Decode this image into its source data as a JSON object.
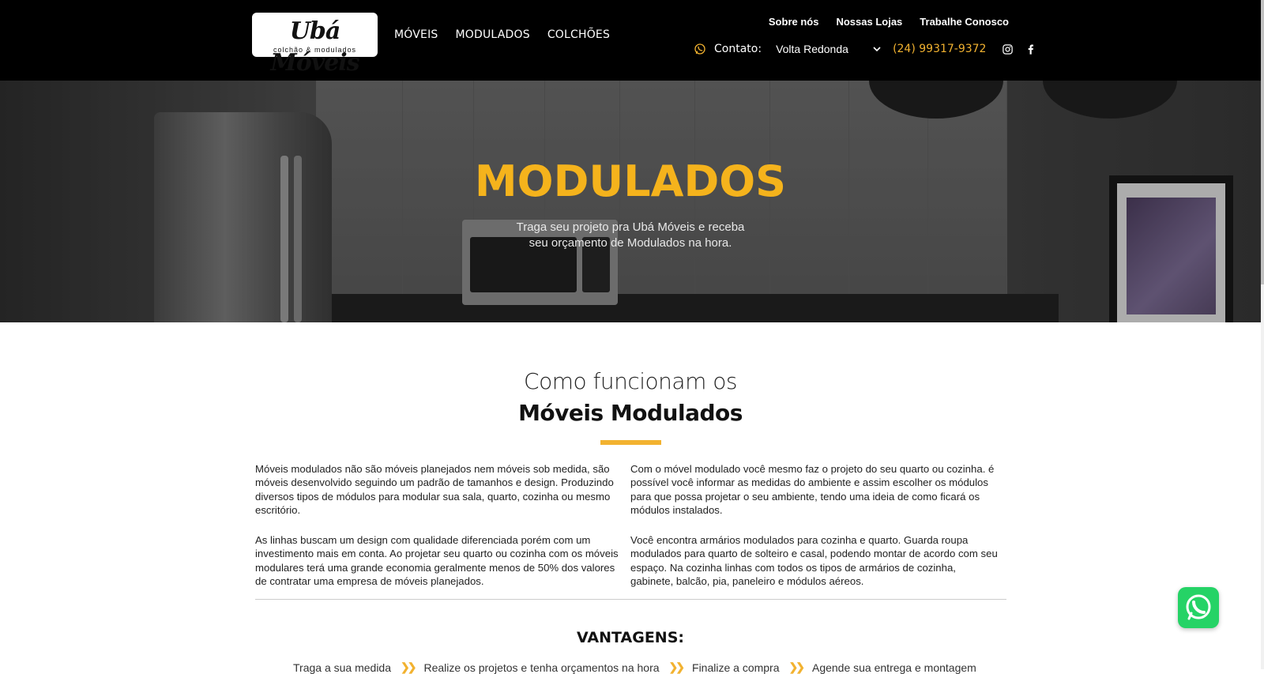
{
  "header": {
    "logo": {
      "name": "Ubá Móveis",
      "tagline": "colchão & modulados"
    },
    "main_nav": [
      "MÓVEIS",
      "MODULADOS",
      "COLCHÕES"
    ],
    "top_links": [
      "Sobre nós",
      "Nossas Lojas",
      "Trabalhe Conosco"
    ],
    "contact": {
      "label": "Contato:",
      "city": "Volta Redonda",
      "phone": "(24) 99317-9372"
    },
    "social_icons": [
      "instagram-icon",
      "facebook-icon"
    ]
  },
  "hero": {
    "title": "MODULADOS",
    "subtitle_line1": "Traga seu projeto pra Ubá Móveis e receba",
    "subtitle_line2": "seu orçamento de Modulados na hora."
  },
  "section": {
    "title_light": "Como funcionam os",
    "title_bold": "Móveis Modulados",
    "left_paragraphs": [
      "Móveis modulados não são móveis planejados nem móveis sob medida, são móveis desenvolvido seguindo um padrão de tamanhos e design. Produzindo diversos tipos de módulos para modular sua sala, quarto, cozinha ou mesmo escritório.",
      "As linhas buscam um design com qualidade diferenciada porém com um investimento mais em conta. Ao projetar seu quarto ou cozinha com os móveis modulares terá uma grande economia geralmente menos de 50% dos valores de contratar uma empresa de móveis planejados."
    ],
    "right_paragraphs": [
      "Com o móvel modulado você mesmo faz o projeto do seu quarto ou cozinha. é possível você informar as medidas do ambiente e assim escolher os módulos para que possa projetar o seu ambiente, tendo uma ideia de como ficará os módulos instalados.",
      "Você encontra armários modulados para cozinha e quarto. Guarda roupa modulados para quarto de solteiro e casal, podendo montar de acordo com seu espaço. Na cozinha linhas com todos os tipos de armários de cozinha, gabinete, balcão, pia, paneleiro e módulos aéreos."
    ]
  },
  "advantages": {
    "title": "VANTAGENS:",
    "steps": [
      "Traga a sua medida",
      "Realize os projetos e tenha orçamentos na hora",
      "Finalize a compra",
      "Agende sua entrega e montagem"
    ]
  },
  "colors": {
    "accent": "#f2b230",
    "hero_title": "#f5b31c",
    "header_bg": "#000000",
    "whatsapp": "#25d366"
  }
}
